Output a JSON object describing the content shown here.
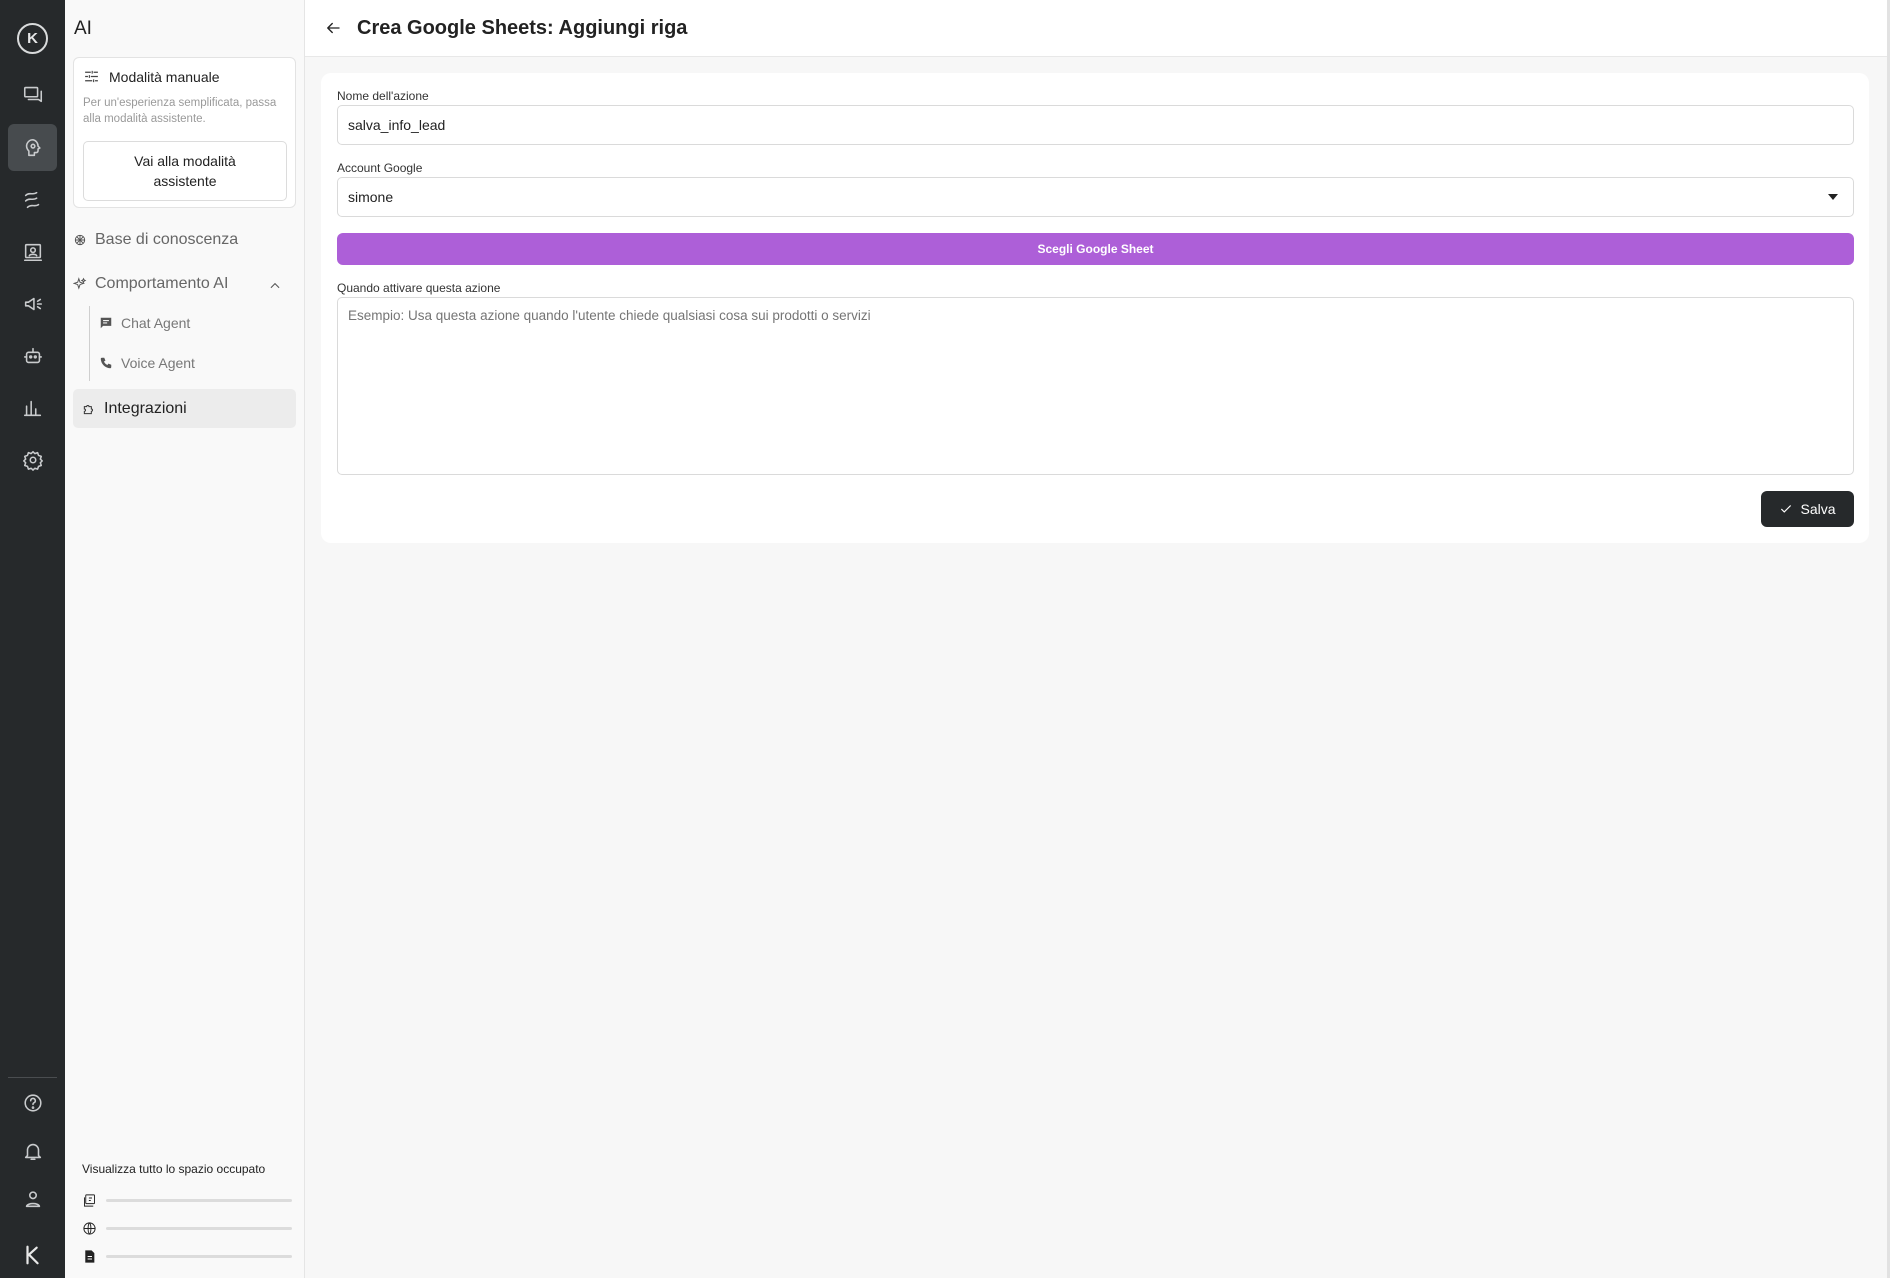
{
  "rail": {
    "items": [
      "logo-icon",
      "conversations-icon",
      "ai-icon",
      "flows-icon",
      "contacts-icon",
      "campaigns-icon",
      "bot-icon",
      "analytics-icon",
      "settings-icon"
    ],
    "bottom": [
      "help-icon",
      "bell-icon",
      "user-icon",
      "brand-icon"
    ],
    "logo_text": "K"
  },
  "sidebar": {
    "title": "AI",
    "mode": {
      "title": "Modalità manuale",
      "description": "Per un'esperienza semplificata, passa alla modalità assistente.",
      "button": "Vai alla modalità assistente"
    },
    "nav": {
      "knowledge": "Base di conoscenza",
      "behavior": "Comportamento AI",
      "chat_agent": "Chat Agent",
      "voice_agent": "Voice Agent",
      "integrations": "Integrazioni"
    },
    "storage": {
      "title": "Visualizza tutto lo spazio occupato",
      "bars": [
        {
          "icon": "documents-icon",
          "fill": 0
        },
        {
          "icon": "globe-icon",
          "fill": 0
        },
        {
          "icon": "file-icon",
          "fill": 0
        }
      ]
    }
  },
  "header": {
    "title": "Crea Google Sheets: Aggiungi riga"
  },
  "form": {
    "action_name_label": "Nome dell'azione",
    "action_name_value": "salva_info_lead",
    "account_label": "Account Google",
    "account_value": "simone",
    "choose_sheet_button": "Scegli Google Sheet",
    "trigger_label": "Quando attivare questa azione",
    "trigger_placeholder": "Esempio: Usa questa azione quando l'utente chiede qualsiasi cosa sui prodotti o servizi",
    "save_button": "Salva"
  },
  "colors": {
    "rail_bg": "#26292b",
    "accent_purple": "#ad5fd8",
    "save_bg": "#26292b"
  }
}
